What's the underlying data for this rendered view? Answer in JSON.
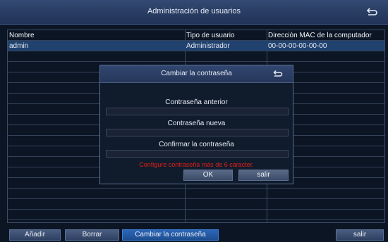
{
  "window": {
    "title": "Administración de usuarios",
    "back_icon": "return-arrow-icon"
  },
  "table": {
    "headers": [
      "Nombre",
      "Tipo de usuario",
      "Dirección MAC de la computador"
    ],
    "rows": [
      [
        "admin",
        "Administrador",
        "00-00-00-00-00-00"
      ]
    ],
    "selected_row": 0
  },
  "buttons": {
    "add": "Añadir",
    "delete": "Borrar",
    "change_password": "Cambiar la contraseña",
    "exit": "salir"
  },
  "dialog": {
    "title": "Cambiar la contraseña",
    "old_password_label": "Contraseña anterior",
    "new_password_label": "Contraseña nueva",
    "confirm_password_label": "Confirmar la contraseña",
    "old_password_value": "",
    "new_password_value": "",
    "confirm_password_value": "",
    "warning": "Configure contraseña más de 6 caracter.",
    "ok": "OK",
    "exit": "salir"
  },
  "colors": {
    "titlebar": "#2c3f66",
    "background": "#0c1524",
    "selected_row": "#21426f",
    "warning": "#e0201a",
    "active_button": "#2d67b8"
  }
}
